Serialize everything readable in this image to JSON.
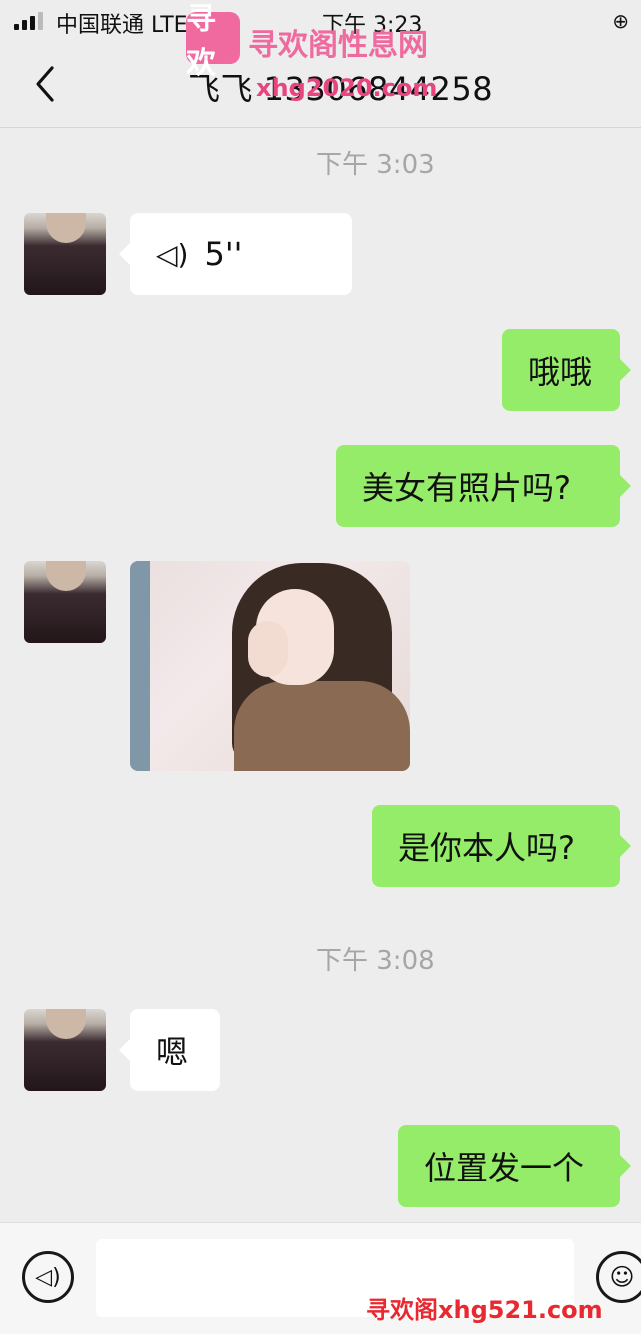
{
  "status_bar": {
    "carrier": "中国联通  LTE",
    "time": "下午 3:23",
    "lock_icon": "orientation-lock-icon"
  },
  "nav": {
    "back_icon": "chevron-left-icon",
    "title": "飞飞 13306844258"
  },
  "watermark": {
    "logo_text": "寻欢",
    "site_name": "寻欢阁性息网",
    "site_url": "xhg2020.com",
    "bottom_text": "寻欢阁xhg521.com"
  },
  "messages": [
    {
      "type": "time",
      "text": "下午 3:03"
    },
    {
      "type": "voice",
      "direction": "in",
      "duration": "5''",
      "icon": "voice-wave-icon"
    },
    {
      "type": "text",
      "direction": "out",
      "text": "哦哦"
    },
    {
      "type": "text",
      "direction": "out",
      "text": "美女有照片吗?"
    },
    {
      "type": "image",
      "direction": "in",
      "caption": ""
    },
    {
      "type": "text",
      "direction": "out",
      "text": "是你本人吗?"
    },
    {
      "type": "time",
      "text": "下午 3:08"
    },
    {
      "type": "text",
      "direction": "in",
      "text": "嗯"
    },
    {
      "type": "text",
      "direction": "out",
      "text": "位置发一个"
    }
  ],
  "input_bar": {
    "voice_icon": "voice-input-icon",
    "input_value": "",
    "emoji_icon": "emoji-icon"
  },
  "colors": {
    "background": "#ededed",
    "incoming_bubble": "#ffffff",
    "outgoing_bubble": "#95ec69"
  }
}
